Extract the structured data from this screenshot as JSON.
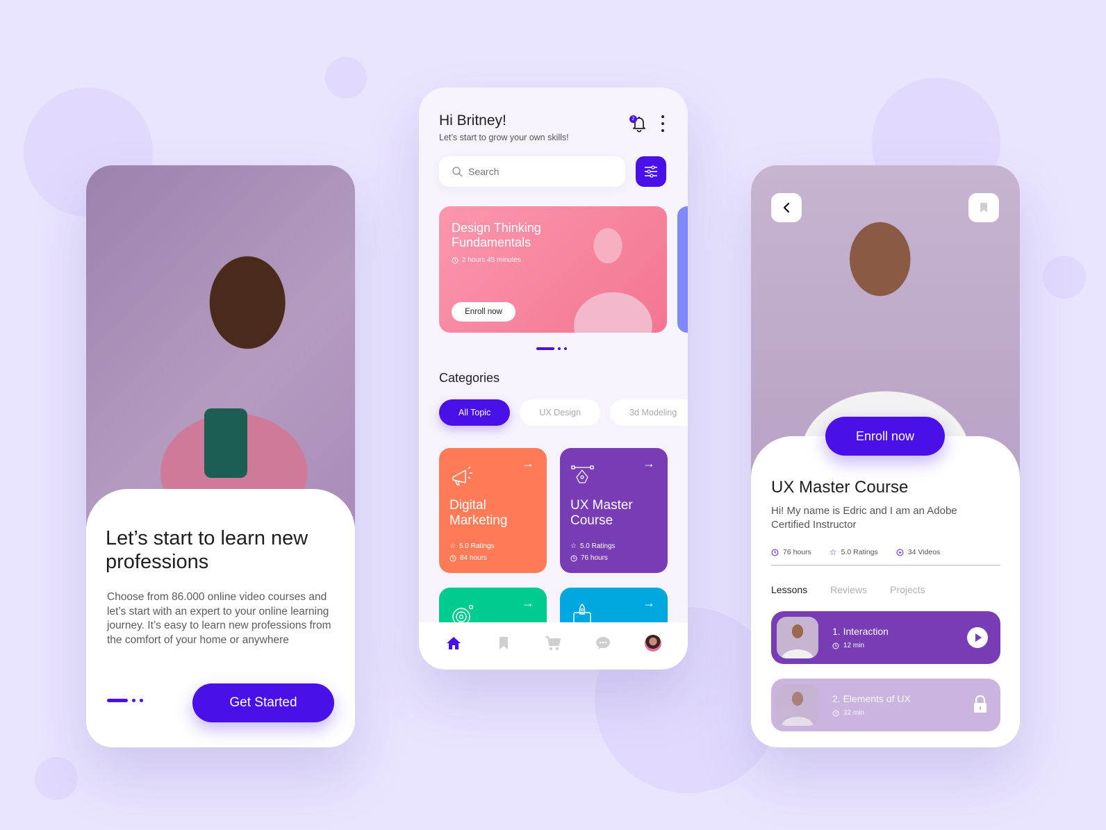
{
  "colors": {
    "background": "#e9e4ff",
    "accent": "#4a10e8",
    "digital_marketing": "#ff7a57",
    "ux_master": "#783cb4",
    "green_card": "#00cc8f",
    "blue_card": "#00a8e0",
    "banner": "#f58aa2",
    "lesson_active": "#783cb4",
    "lesson_locked": "#cbb4df"
  },
  "onboarding": {
    "title": "Let’s start to learn new professions",
    "description": "Choose from 86.000 online video courses and let’s start with an expert to your online learning journey. It’s easy to learn new professions from the comfort of your home or anywhere",
    "cta": "Get Started",
    "page_indicator": {
      "current": 1,
      "total": 3
    }
  },
  "home": {
    "greeting": "Hi Britney!",
    "subtitle": "Let’s start to grow your own skills!",
    "notification_count": "2",
    "search_placeholder": "Search",
    "banner": {
      "title": "Design Thinking Fundamentals",
      "duration": "2 hours 45 minutes",
      "button": "Enroll now"
    },
    "carousel_indicator": {
      "current": 1,
      "total": 3
    },
    "categories_title": "Categories",
    "chips": [
      {
        "label": "All Topic",
        "active": true
      },
      {
        "label": "UX Design",
        "active": false
      },
      {
        "label": "3d Modeling",
        "active": false
      }
    ],
    "courses": [
      {
        "title": "Digital Marketing",
        "ratings": "5.0 Ratings",
        "hours": "84 hours",
        "icon": "megaphone-icon"
      },
      {
        "title": "UX Master Course",
        "ratings": "5.0 Ratings",
        "hours": "76 hours",
        "icon": "pen-tool-icon"
      },
      {
        "title": "",
        "icon": "target-icon"
      },
      {
        "title": "",
        "icon": "rocket-icon"
      }
    ],
    "nav": [
      "home-icon",
      "bookmark-icon",
      "cart-icon",
      "chat-icon",
      "profile-avatar"
    ]
  },
  "detail": {
    "enroll": "Enroll now",
    "title": "UX Master Course",
    "description": "Hi! My name is Edric and I am an Adobe Certified Instructor",
    "stats": {
      "hours": "76 hours",
      "ratings": "5.0 Ratings",
      "videos": "34 Videos"
    },
    "tabs": [
      {
        "label": "Lessons",
        "active": true
      },
      {
        "label": "Reviews",
        "active": false
      },
      {
        "label": "Projects",
        "active": false
      }
    ],
    "lessons": [
      {
        "name": "1. Interaction",
        "duration": "12 min",
        "state": "play"
      },
      {
        "name": "2.  Elements of UX",
        "duration": "32 min",
        "state": "locked"
      }
    ]
  }
}
